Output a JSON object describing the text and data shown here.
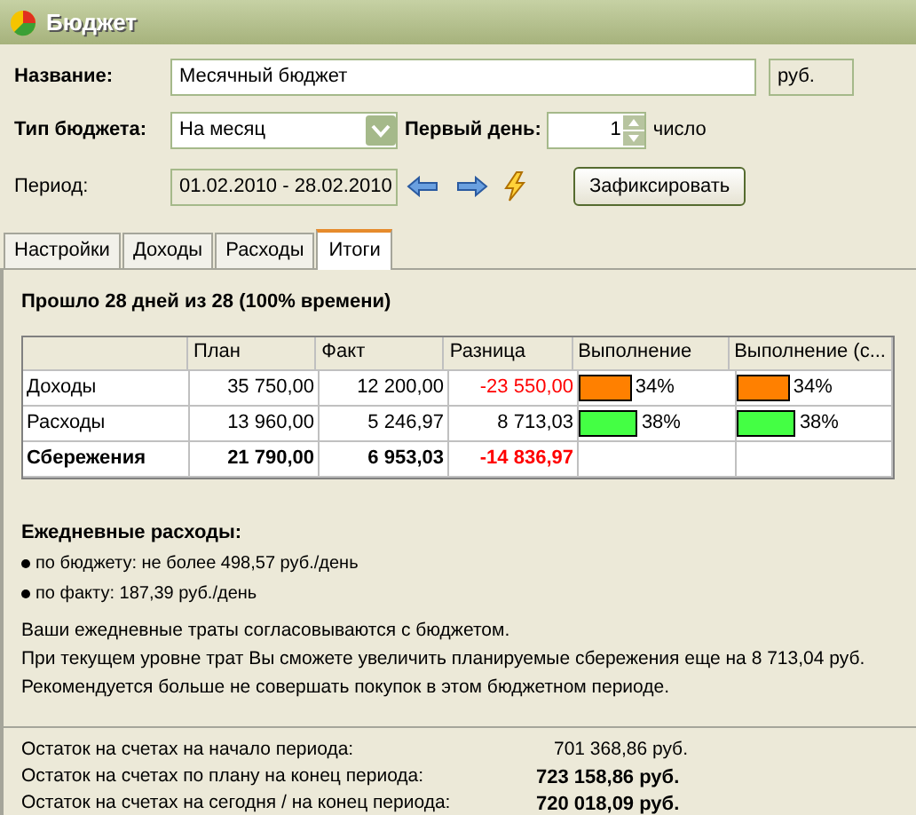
{
  "window": {
    "title": "Бюджет"
  },
  "form": {
    "name_label": "Название:",
    "name_value": "Месячный бюджет",
    "currency": "руб.",
    "type_label": "Тип бюджета:",
    "type_value": "На месяц",
    "first_day_label": "Первый день:",
    "first_day_value": "1",
    "first_day_unit": "число",
    "period_label": "Период:",
    "period_value": "01.02.2010 - 28.02.2010",
    "fix_button": "Зафиксировать"
  },
  "tabs": [
    {
      "label": "Настройки",
      "selected": false
    },
    {
      "label": "Доходы",
      "selected": false
    },
    {
      "label": "Расходы",
      "selected": false
    },
    {
      "label": "Итоги",
      "selected": true
    }
  ],
  "summary": {
    "heading": "Прошло 28 дней из 28 (100% времени)"
  },
  "table": {
    "columns": [
      "",
      "План",
      "Факт",
      "Разница",
      "Выполнение",
      "Выполнение (с..."
    ],
    "rows": [
      {
        "kind": "item",
        "label": "Доходы",
        "plan": "35 750,00",
        "fact": "12 200,00",
        "diff": "-23 550,00",
        "negative": true,
        "progress": [
          {
            "level": 0.34,
            "color": "#ff8000",
            "reading": "34%"
          },
          {
            "level": 0.34,
            "color": "#ff8000",
            "reading": "34%"
          }
        ]
      },
      {
        "kind": "item",
        "label": "Расходы",
        "plan": "13 960,00",
        "fact": "5 246,97",
        "diff": "8 713,03",
        "negative": false,
        "progress": [
          {
            "level": 0.38,
            "color": "#44ff44",
            "reading": "38%"
          },
          {
            "level": 0.38,
            "color": "#44ff44",
            "reading": "38%"
          }
        ]
      },
      {
        "kind": "total",
        "label": "Сбережения",
        "plan": "21 790,00",
        "fact": "6 953,03",
        "diff": "-14 836,97",
        "negative": true,
        "progress": []
      }
    ]
  },
  "daily": {
    "heading": "Ежедневные расходы:",
    "items": [
      "по бюджету: не более 498,57 руб./день",
      "по факту: 187,39 руб./день"
    ]
  },
  "advice": [
    "Ваши ежедневные траты согласовываются с бюджетом.",
    "При текущем уровне трат Вы сможете увеличить планируемые сбережения еще на 8 713,04 руб.",
    "Рекомендуется больше не совершать покупок в этом бюджетном периоде."
  ],
  "balances": [
    {
      "label": "Остаток на счетах на начало периода:",
      "value": "701 368,86 руб.",
      "bold": false
    },
    {
      "label": "Остаток на счетах по плану на конец периода:",
      "value": "723 158,86 руб.",
      "bold": true
    },
    {
      "label": "Остаток на счетах на сегодня / на конец периода:",
      "value": "720 018,09 руб.",
      "bold": true
    }
  ]
}
